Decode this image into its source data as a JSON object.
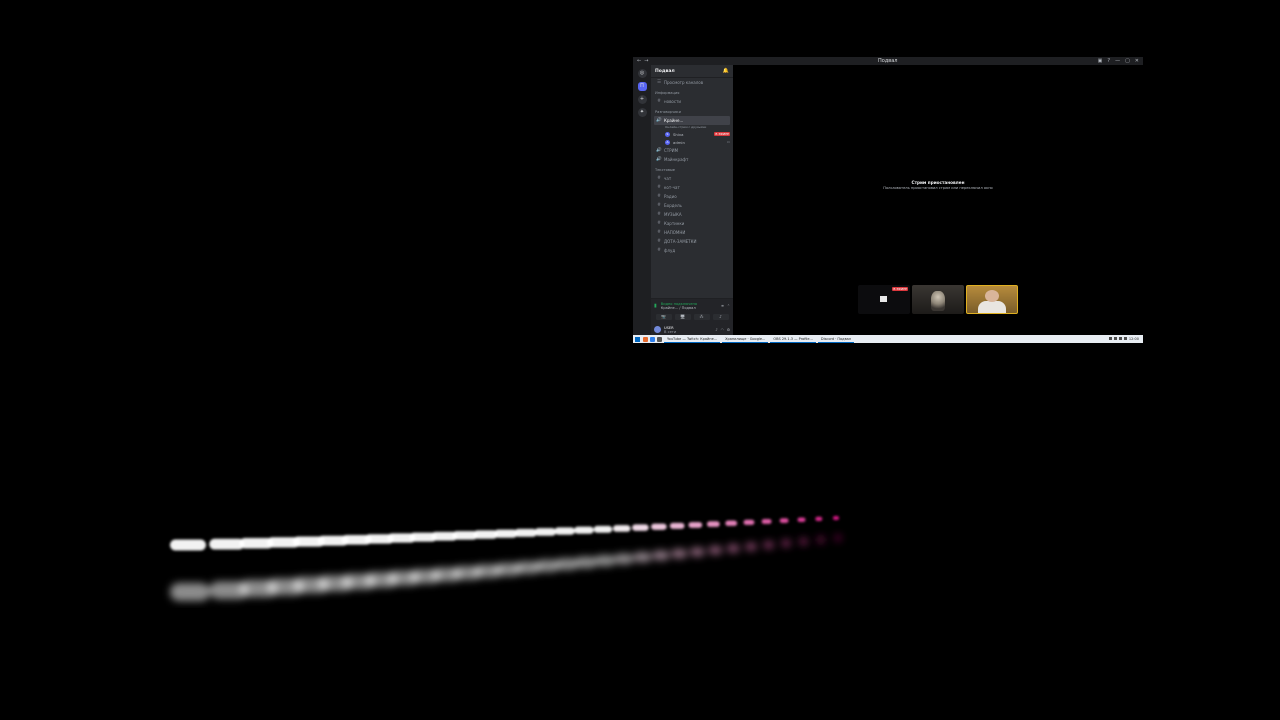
{
  "window": {
    "title": "Подвал",
    "controls": [
      "—",
      "▢",
      "✕"
    ]
  },
  "guilds": [
    {
      "name": "discord-home-icon",
      "glyph": "◎"
    },
    {
      "name": "server-podval-icon",
      "glyph": "П"
    },
    {
      "name": "add-server-icon",
      "glyph": "+"
    },
    {
      "name": "explore-icon",
      "glyph": "✦"
    }
  ],
  "sidebar": {
    "server_name": "Подвал",
    "browse_channels": "Просмотр каналов",
    "categories": [
      {
        "label": "Информация",
        "channels": [
          {
            "icon": "#",
            "label": "новости"
          }
        ]
      },
      {
        "label": "Разговорчики",
        "channels": [
          {
            "icon": "🔊",
            "label": "Крайне...",
            "selected": true,
            "sub": "Онлайн-стрим с друзьями"
          },
          {
            "icon": "🔊",
            "label": "СТРИМ"
          },
          {
            "icon": "🔊",
            "label": "Майнкрафт"
          }
        ],
        "members": [
          {
            "name": "Shiva",
            "badge": "В ЭФИРЕ"
          },
          {
            "name": "admin",
            "badge": ""
          }
        ]
      },
      {
        "label": "Текстовые",
        "channels": [
          {
            "icon": "#",
            "label": "чат"
          },
          {
            "icon": "#",
            "label": "кот-чат"
          },
          {
            "icon": "#",
            "label": "Радио"
          },
          {
            "icon": "#",
            "label": "Бордель"
          },
          {
            "icon": "#",
            "label": "МУЗЫКА"
          },
          {
            "icon": "#",
            "label": "Картинки"
          },
          {
            "icon": "#",
            "label": "НАПОМНИ"
          },
          {
            "icon": "#",
            "label": "ДОТА-ЗАМЕТКИ"
          },
          {
            "icon": "#",
            "label": "флуд"
          }
        ]
      }
    ],
    "voice_panel": {
      "status": "Видео подключено",
      "channel": "Крайне... / Подвал",
      "buttons": [
        "📷",
        "🖥",
        "⁂",
        "♪"
      ]
    },
    "user": {
      "name": "USER",
      "status": "В сети"
    }
  },
  "stage": {
    "stream_title": "Стрим приостановлен",
    "stream_sub": "Пользователь приостановил стрим или переключил окно",
    "tiles": [
      {
        "name": "screen-share-tile",
        "live": "В ЭФИРЕ"
      },
      {
        "name": "avatar-tile-figure"
      },
      {
        "name": "webcam-tile-person"
      }
    ]
  },
  "taskbar": {
    "tasks": [
      "YouTube — Twitch: Крайне...",
      "Хранилище · Google...",
      "OBS 29.1.3 — Profile...",
      "Discord · Подвал"
    ],
    "tray": "12:00"
  },
  "colors": {
    "discord_dark": "#2b2d31",
    "discord_darker": "#1e1f22",
    "live_red": "#da373c",
    "online_green": "#23a559",
    "streak_white": "#ffffff",
    "streak_pink": "#e0198b"
  }
}
